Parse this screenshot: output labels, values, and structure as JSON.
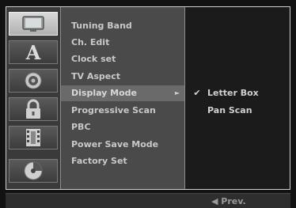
{
  "sidebar": {
    "icons": [
      {
        "name": "tv-icon",
        "active": true
      },
      {
        "name": "language-icon",
        "glyph": "A"
      },
      {
        "name": "audio-speaker-icon"
      },
      {
        "name": "lock-icon"
      },
      {
        "name": "film-icon"
      },
      {
        "name": "disc-icon"
      }
    ]
  },
  "menu": {
    "items": [
      {
        "label": "Tuning Band"
      },
      {
        "label": "Ch. Edit"
      },
      {
        "label": "Clock set"
      },
      {
        "label": "TV Aspect"
      },
      {
        "label": "Display Mode",
        "selected": true
      },
      {
        "label": "Progressive Scan"
      },
      {
        "label": "PBC"
      },
      {
        "label": "Power Save Mode"
      },
      {
        "label": "Factory Set"
      }
    ],
    "submenu_arrow": "►"
  },
  "options": {
    "items": [
      {
        "label": "Letter Box",
        "checked": true
      },
      {
        "label": "Pan Scan",
        "checked": false
      }
    ],
    "check_glyph": "✔"
  },
  "footer": {
    "prev_label": "◀ Prev."
  },
  "colors": {
    "background": "#121212",
    "icon_column": "#3a3a3a",
    "menu_column": "#4a4a4a",
    "selected_row": "#6a6a6a",
    "text": "#c8c8c8"
  }
}
